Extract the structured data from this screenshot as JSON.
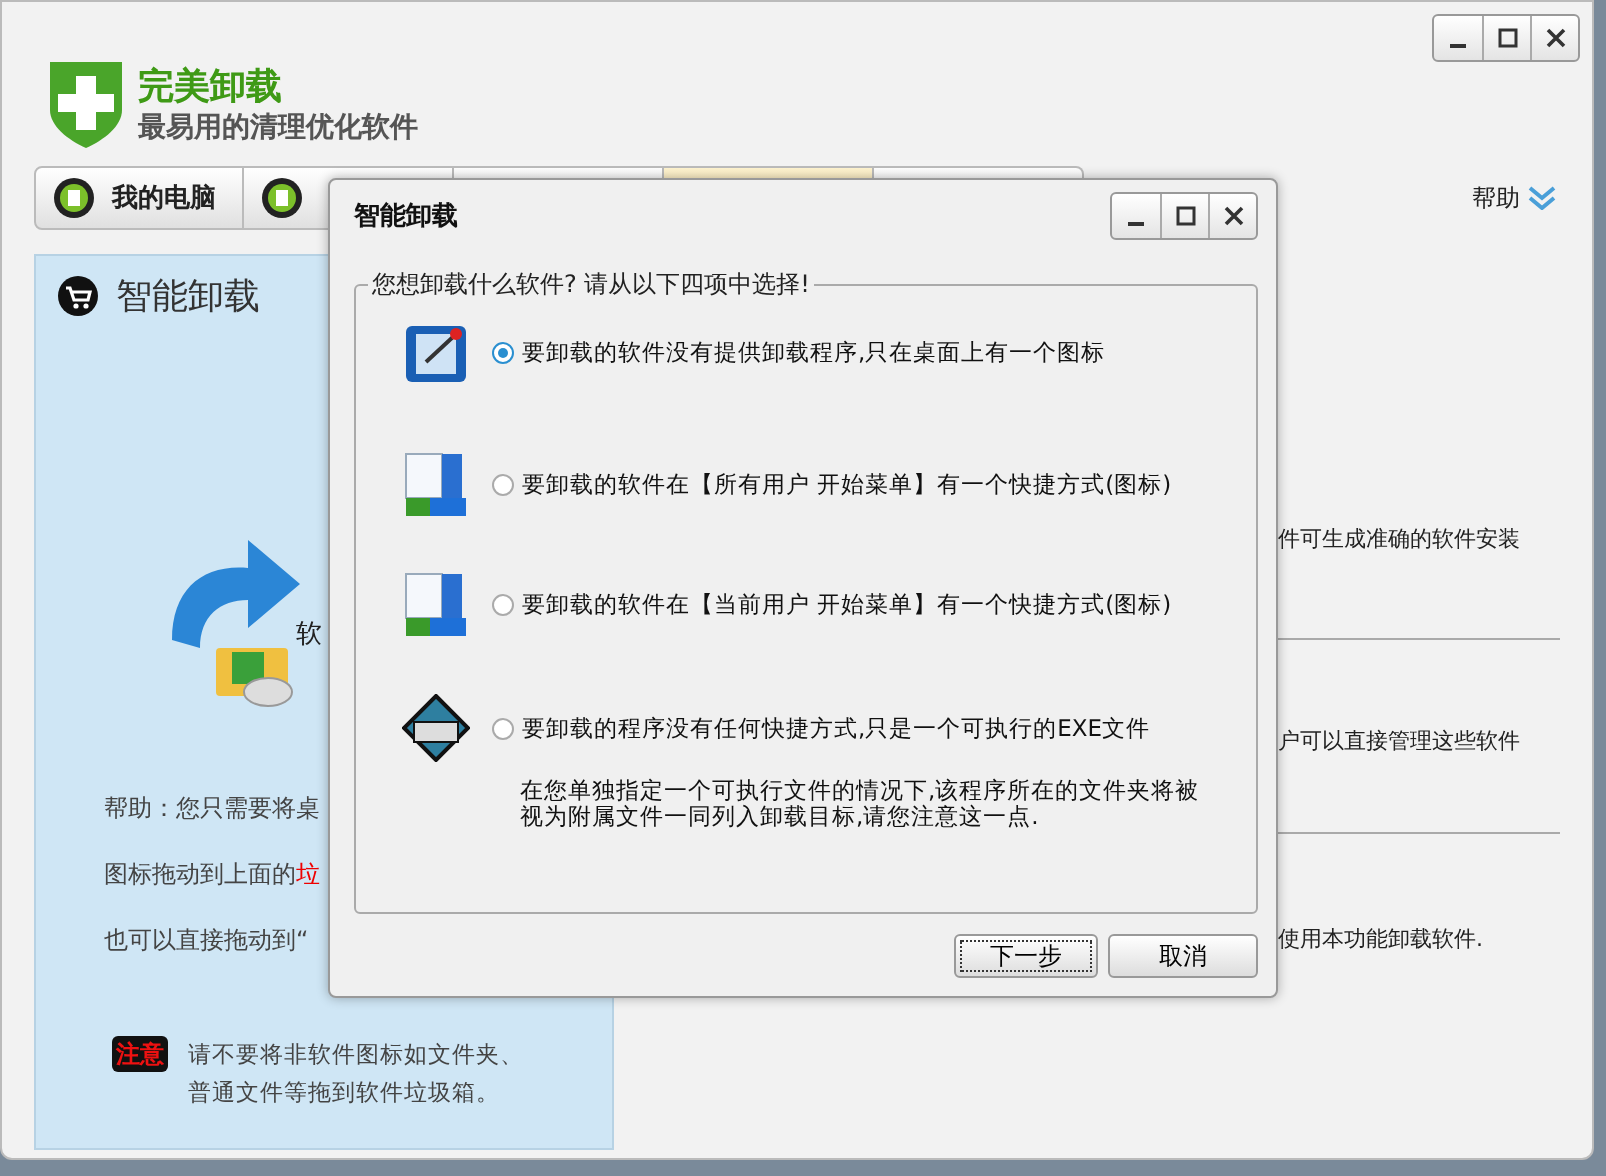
{
  "app": {
    "title": "完美卸载",
    "subtitle": "最易用的清理优化软件"
  },
  "tabs": [
    {
      "label": "我的电脑",
      "selected": false
    },
    {
      "selected": false
    },
    {
      "selected": false
    },
    {
      "selected": true
    },
    {
      "selected": false
    }
  ],
  "help_menu": {
    "label": "帮助"
  },
  "left_panel": {
    "title": "智能卸载",
    "drop_label": "软",
    "help_lines": [
      {
        "text": "帮助：您只需要将桌"
      },
      {
        "text": "图标拖动到上面的",
        "highlight": "垃"
      },
      {
        "text": "也可以直接拖动到“"
      }
    ],
    "note": {
      "badge": "注意",
      "text": "请不要将非软件图标如文件夹、普通文件等拖到软件垃圾箱。"
    }
  },
  "right_panel": {
    "lines": [
      "件可生成准确的软件安装",
      "户可以直接管理这些软件",
      "使用本功能卸载软件."
    ]
  },
  "dialog": {
    "title": "智能卸载",
    "group_label": "您想卸载什么软件? 请从以下四项中选择!",
    "options": [
      {
        "kind": "desktop",
        "label": "要卸载的软件没有提供卸载程序,只在桌面上有一个图标",
        "selected": true
      },
      {
        "kind": "menu",
        "label": "要卸载的软件在【所有用户 开始菜单】有一个快捷方式(图标)",
        "selected": false
      },
      {
        "kind": "menu",
        "label": "要卸载的软件在【当前用户 开始菜单】有一个快捷方式(图标)",
        "selected": false
      },
      {
        "kind": "exe",
        "label": "要卸载的程序没有任何快捷方式,只是一个可执行的EXE文件",
        "note": "在您单独指定一个可执行文件的情况下,该程序所在的文件夹将被视为附属文件一同列入卸载目标,请您注意这一点.",
        "selected": false
      }
    ],
    "buttons": [
      {
        "label": "下一步",
        "focused": true
      },
      {
        "label": "取消",
        "focused": false
      }
    ]
  }
}
